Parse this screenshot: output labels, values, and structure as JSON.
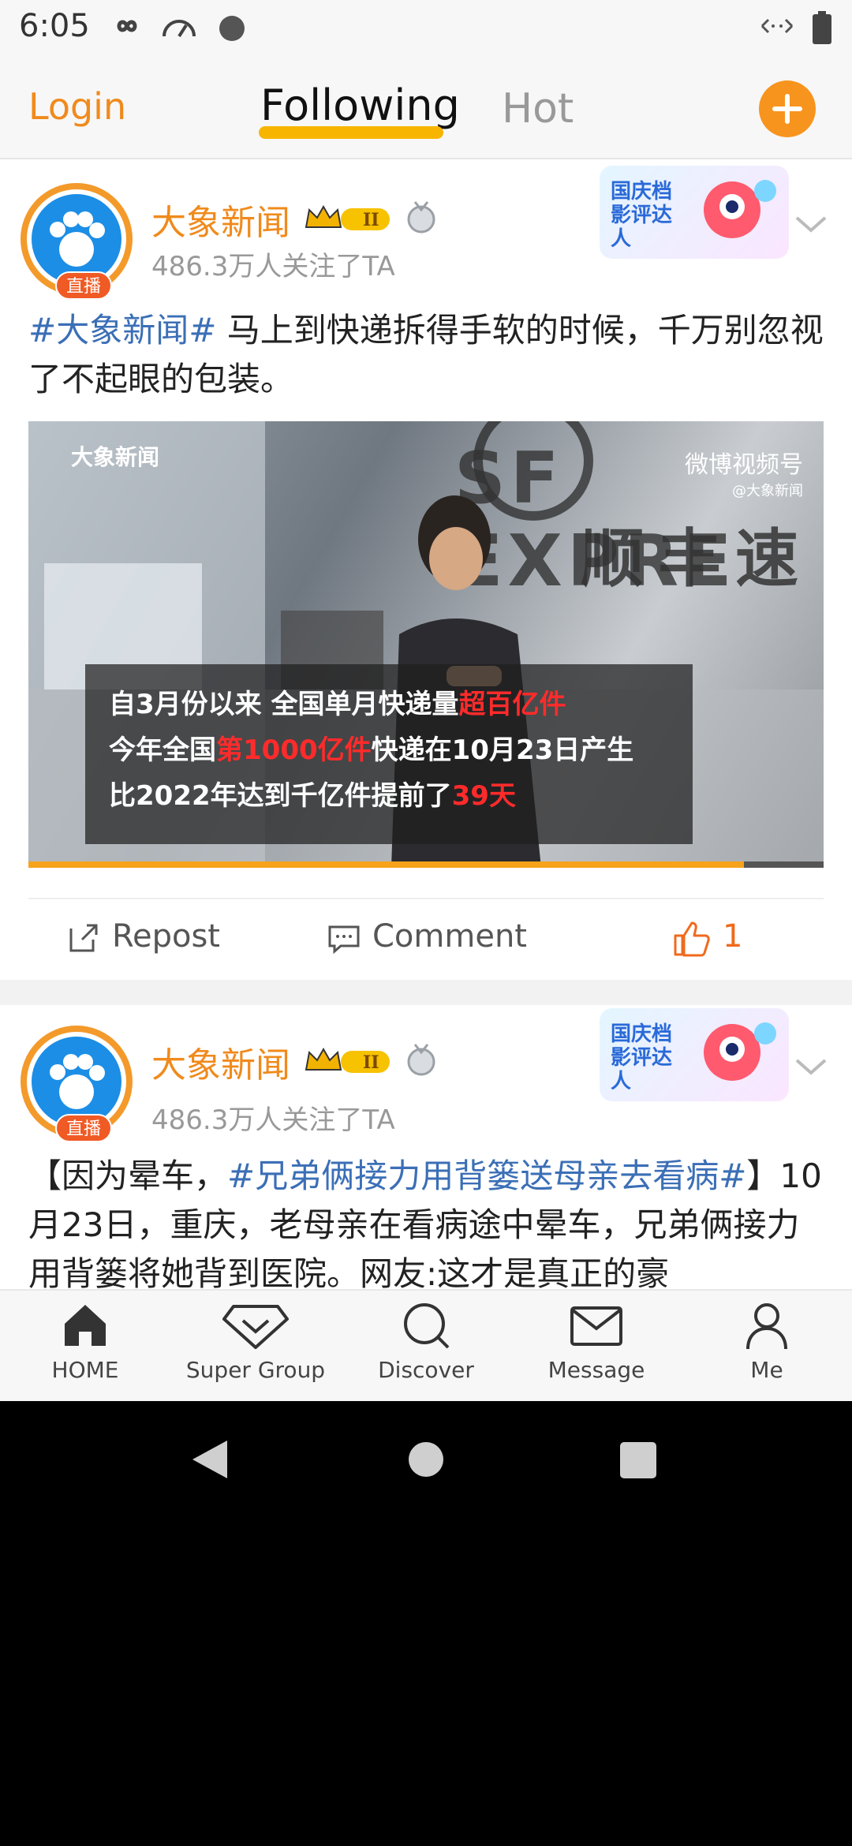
{
  "status_bar": {
    "time": "6:05"
  },
  "top_nav": {
    "login": "Login",
    "following": "Following",
    "hot": "Hot",
    "add_icon": "plus-icon"
  },
  "posts": [
    {
      "author": "大象新闻",
      "followers": "486.3万人关注了TA",
      "live_badge": "直播",
      "promo_text": "国庆档影评达人",
      "text_topic": "#大象新闻#",
      "text_body": " 马上到快递拆得手软的时候，千万别忽视了不起眼的包装。",
      "video": {
        "logo": "大象新闻",
        "watermark": "微博视频号",
        "watermark_sub": "@大象新闻",
        "sign_en": "SF EXPRE",
        "sign_cn": "顺丰速",
        "caption_1a": "自3月份以来 全国单月快递量",
        "caption_1b": "超百亿件",
        "caption_2a": "今年全国",
        "caption_2b": "第1000亿件",
        "caption_2c": "快递在10月23日产生",
        "caption_3a": "比2022年达到千亿件提前了",
        "caption_3b": "39天",
        "progress": 0.9
      },
      "actions": {
        "repost": "Repost",
        "comment": "Comment",
        "likes": "1"
      }
    },
    {
      "author": "大象新闻",
      "followers": "486.3万人关注了TA",
      "live_badge": "直播",
      "promo_text": "国庆档影评达人",
      "text_pre": "【因为晕车，",
      "text_topic": "#兄弟俩接力用背篓送母亲去看病#",
      "text_post": "】10月23日，重庆，老母亲在看病途中晕车，兄弟俩接力用背篓将她背到医院。网友:这才是真正的豪"
    }
  ],
  "bottom_nav": [
    {
      "label": "HOME",
      "icon": "home-icon"
    },
    {
      "label": "Super Group",
      "icon": "diamond-icon"
    },
    {
      "label": "Discover",
      "icon": "search-icon"
    },
    {
      "label": "Message",
      "icon": "mail-icon"
    },
    {
      "label": "Me",
      "icon": "person-icon"
    }
  ],
  "colors": {
    "accent": "#f08a1c",
    "topic": "#3b6fb6",
    "highlight_red": "#ff2b2b",
    "underline": "#f7b500"
  }
}
